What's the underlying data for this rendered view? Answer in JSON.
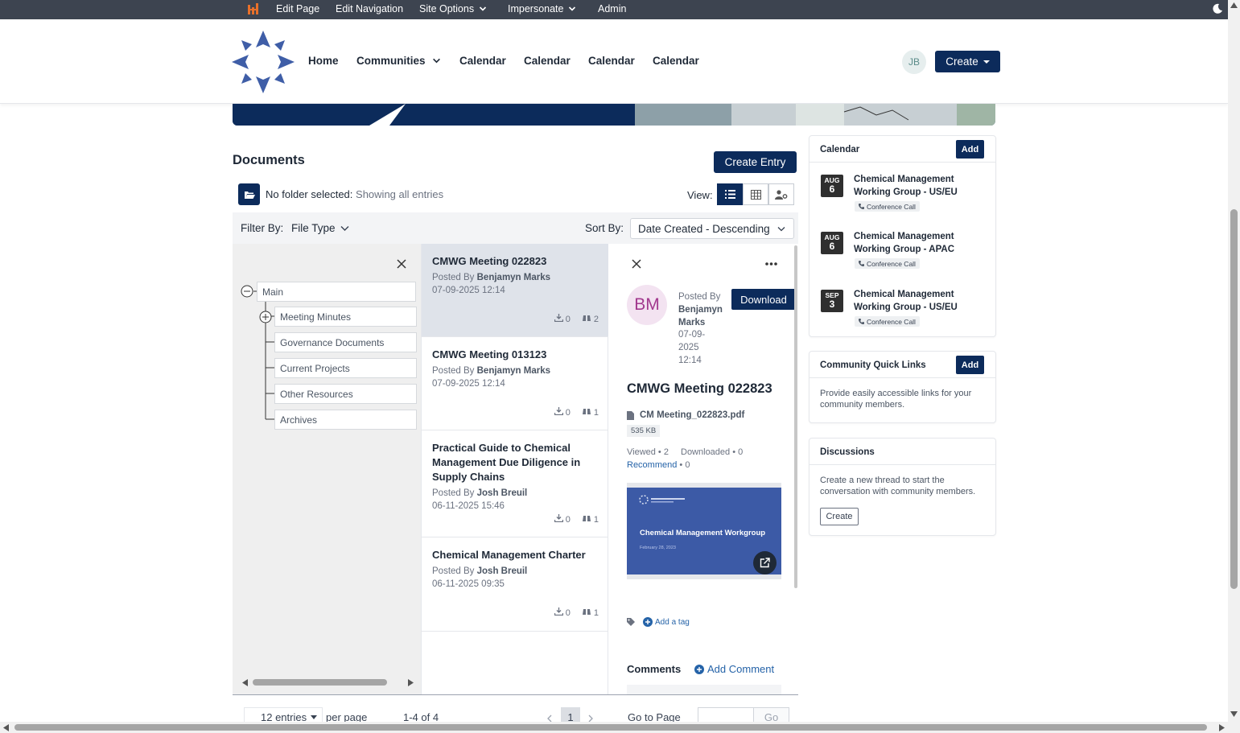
{
  "admin_bar": {
    "items": [
      "Edit Page",
      "Edit Navigation",
      "Site Options",
      "Impersonate",
      "Admin"
    ]
  },
  "nav": {
    "home": "Home",
    "communities": "Communities",
    "cal1": "Calendar",
    "cal2": "Calendar",
    "cal3": "Calendar",
    "cal4": "Calendar",
    "avatar": "JB",
    "create": "Create"
  },
  "documents": {
    "title": "Documents",
    "create_entry": "Create Entry",
    "no_folder": "No folder selected:",
    "showing": "Showing all entries",
    "view_label": "View:",
    "filter_by": "Filter By:",
    "file_type": "File Type",
    "sort_by": "Sort By:",
    "sort_value": "Date Created - Descending"
  },
  "tree": {
    "root": "Main",
    "children": [
      "Meeting Minutes",
      "Governance Documents",
      "Current Projects",
      "Other Resources",
      "Archives"
    ]
  },
  "entries": [
    {
      "title": "CMWG Meeting 022823",
      "posted_by": "Posted By",
      "author": "Benjamyn Marks",
      "date": "07-09-2025 12:14",
      "downloads": "0",
      "views": "2"
    },
    {
      "title": "CMWG Meeting 013123",
      "posted_by": "Posted By",
      "author": "Benjamyn Marks",
      "date": "07-09-2025 12:14",
      "downloads": "0",
      "views": "1"
    },
    {
      "title": "Practical Guide to Chemical Management Due Diligence in Supply Chains",
      "posted_by": "Posted By",
      "author": "Josh Breuil",
      "date": "06-11-2025 15:46",
      "downloads": "0",
      "views": "1"
    },
    {
      "title": "Chemical Management Charter",
      "posted_by": "Posted By",
      "author": "Josh Breuil",
      "date": "06-11-2025 09:35",
      "downloads": "0",
      "views": "1"
    }
  ],
  "detail": {
    "avatar": "BM",
    "posted_by": "Posted By",
    "author_first": "Benjamyn",
    "author_last": "Marks",
    "date_a": "07-09-",
    "date_b": "2025",
    "time": "12:14",
    "download": "Download",
    "title": "CMWG Meeting 022823",
    "file_name": "CM Meeting_022823.pdf",
    "file_size": "535 KB",
    "viewed": "Viewed • 2",
    "downloaded": "Downloaded • 0",
    "recommend": "Recommend",
    "recommend_count": "• 0",
    "preview_title": "Chemical Management Workgroup",
    "preview_date": "February 28, 2023",
    "add_tag": "Add a tag",
    "comments": "Comments",
    "add_comment": "Add Comment"
  },
  "calendar": {
    "title": "Calendar",
    "add": "Add",
    "events": [
      {
        "month": "AUG",
        "day": "6",
        "title": "Chemical Management Working Group - US/EU",
        "tag": "Conference Call"
      },
      {
        "month": "AUG",
        "day": "6",
        "title": "Chemical Management Working Group - APAC",
        "tag": "Conference Call"
      },
      {
        "month": "SEP",
        "day": "3",
        "title": "Chemical Management Working Group - US/EU",
        "tag": "Conference Call"
      }
    ]
  },
  "quick_links": {
    "title": "Community Quick Links",
    "add": "Add",
    "text": "Provide easily accessible links for your community members."
  },
  "discussions": {
    "title": "Discussions",
    "text": "Create a new thread to start the conversation with community members.",
    "create": "Create"
  },
  "pager": {
    "entries": "12 entries",
    "per_page": "per page",
    "range": "1-4 of 4",
    "current": "1",
    "goto": "Go to Page",
    "go": "Go"
  },
  "colors": {
    "primary": "#0c2b5b",
    "admin_bar": "#3d4450",
    "logo_blue": "#3f5ea7",
    "link": "#2563a8"
  }
}
